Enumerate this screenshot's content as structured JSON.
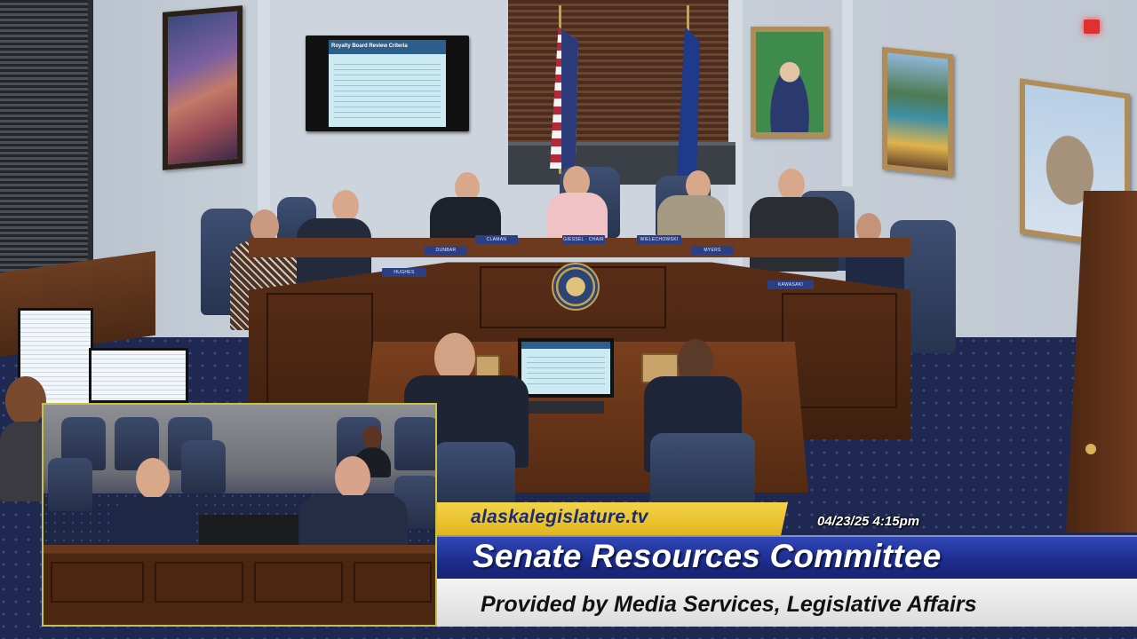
{
  "wall_slide": {
    "title": "Royalty Board Review Criteria"
  },
  "nameplates": [
    "HUGHES",
    "DUNBAR",
    "CLAMAN",
    "GIESSEL · CHAIR",
    "WIELECHOWSKI",
    "MYERS",
    "KAWASAKI"
  ],
  "lower_third": {
    "url": "alaskalegislature.tv",
    "timestamp": "04/23/25 4:15pm",
    "title": "Senate Resources Committee",
    "subtitle": "Provided by Media Services, Legislative Affairs"
  },
  "colors": {
    "url_bar": "#e3b51f",
    "title_bar": "#1d2c8c",
    "subtitle_bar": "#dcdcdc",
    "pip_border": "#c9c04a"
  }
}
